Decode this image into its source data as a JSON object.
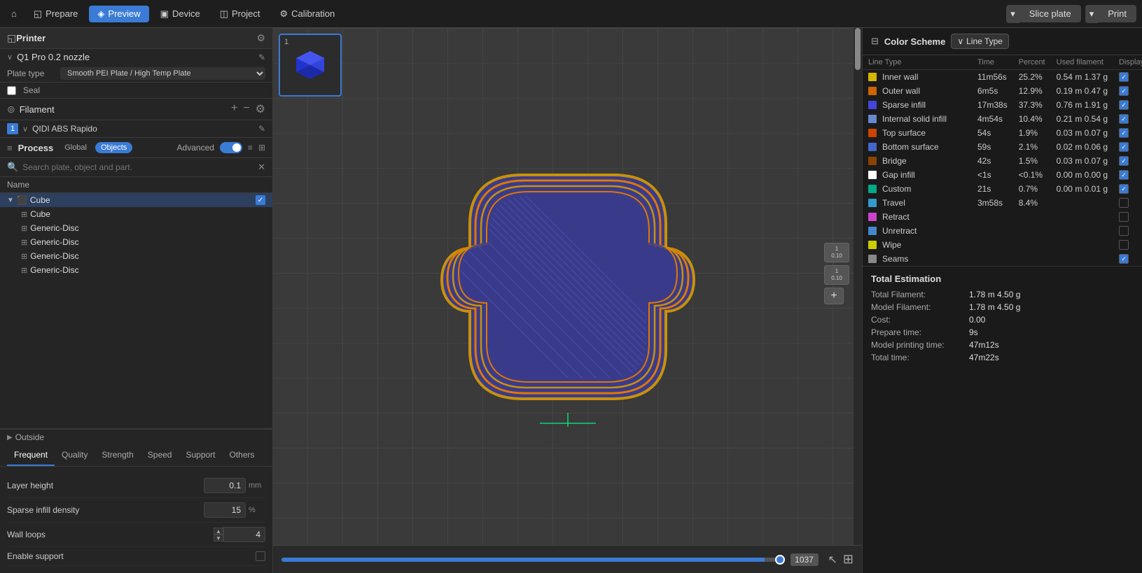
{
  "topbar": {
    "home_icon": "⌂",
    "prepare_label": "Prepare",
    "preview_label": "Preview",
    "device_label": "Device",
    "project_label": "Project",
    "calibration_label": "Calibration",
    "slice_label": "Slice plate",
    "print_label": "Print"
  },
  "left": {
    "printer_section": "Printer",
    "gear_icon": "⚙",
    "printer_name": "Q1 Pro 0.2 nozzle",
    "edit_icon": "✎",
    "plate_label": "Plate type",
    "plate_value": "Smooth PEI Plate / High Temp Plate",
    "seal_label": "Seal",
    "filament_label": "Filament",
    "filament_add": "+",
    "filament_remove": "−",
    "filament_num": "1",
    "filament_name": "QIDI ABS Rapido",
    "process_label": "Process",
    "global_tab": "Global",
    "objects_tab": "Objects",
    "advanced_label": "Advanced",
    "search_placeholder": "Search plate, object and part.",
    "tree_name_col": "Name",
    "tree_items": [
      {
        "label": "Cube",
        "level": 0,
        "type": "group",
        "checked": true
      },
      {
        "label": "Cube",
        "level": 1,
        "type": "cube"
      },
      {
        "label": "Generic-Disc",
        "level": 1,
        "type": "link"
      },
      {
        "label": "Generic-Disc",
        "level": 1,
        "type": "link"
      },
      {
        "label": "Generic-Disc",
        "level": 1,
        "type": "link"
      },
      {
        "label": "Generic-Disc",
        "level": 1,
        "type": "link"
      }
    ],
    "outside_label": "Outside",
    "tabs": [
      "Frequent",
      "Quality",
      "Strength",
      "Speed",
      "Support",
      "Others"
    ],
    "active_tab": "Frequent",
    "settings": [
      {
        "label": "Layer height",
        "value": "0.1",
        "unit": "mm"
      },
      {
        "label": "Sparse infill density",
        "value": "15",
        "unit": "%"
      },
      {
        "label": "Wall loops",
        "value": "4",
        "unit": ""
      },
      {
        "label": "Enable support",
        "value": "",
        "unit": "checkbox"
      }
    ]
  },
  "canvas": {
    "layer_value": "1037"
  },
  "right": {
    "color_scheme_label": "Color Scheme",
    "line_type_label": "Line Type",
    "columns": [
      "Line Type",
      "Time",
      "Percent",
      "Used filament",
      "Display"
    ],
    "lines": [
      {
        "name": "Inner wall",
        "color": "#d4b800",
        "time": "11m56s",
        "percent": "25.2%",
        "filament": "0.54 m  1.37 g",
        "display": true
      },
      {
        "name": "Outer wall",
        "color": "#cc6600",
        "time": "6m5s",
        "percent": "12.9%",
        "filament": "0.19 m  0.47 g",
        "display": true
      },
      {
        "name": "Sparse infill",
        "color": "#4444dd",
        "time": "17m38s",
        "percent": "37.3%",
        "filament": "0.76 m  1.91 g",
        "display": true
      },
      {
        "name": "Internal solid infill",
        "color": "#6688cc",
        "time": "4m54s",
        "percent": "10.4%",
        "filament": "0.21 m  0.54 g",
        "display": true
      },
      {
        "name": "Top surface",
        "color": "#cc4400",
        "time": "54s",
        "percent": "1.9%",
        "filament": "0.03 m  0.07 g",
        "display": true
      },
      {
        "name": "Bottom surface",
        "color": "#4466cc",
        "time": "59s",
        "percent": "2.1%",
        "filament": "0.02 m  0.06 g",
        "display": true
      },
      {
        "name": "Bridge",
        "color": "#884400",
        "time": "42s",
        "percent": "1.5%",
        "filament": "0.03 m  0.07 g",
        "display": true
      },
      {
        "name": "Gap infill",
        "color": "#ffffff",
        "time": "<1s",
        "percent": "<0.1%",
        "filament": "0.00 m  0.00 g",
        "display": true
      },
      {
        "name": "Custom",
        "color": "#00aa88",
        "time": "21s",
        "percent": "0.7%",
        "filament": "0.00 m  0.01 g",
        "display": true
      },
      {
        "name": "Travel",
        "color": "#3399cc",
        "time": "3m58s",
        "percent": "8.4%",
        "filament": "",
        "display": false
      },
      {
        "name": "Retract",
        "color": "#cc44cc",
        "time": "",
        "percent": "",
        "filament": "",
        "display": false
      },
      {
        "name": "Unretract",
        "color": "#4488cc",
        "time": "",
        "percent": "",
        "filament": "",
        "display": false
      },
      {
        "name": "Wipe",
        "color": "#cccc00",
        "time": "",
        "percent": "",
        "filament": "",
        "display": false
      },
      {
        "name": "Seams",
        "color": "#888888",
        "time": "",
        "percent": "",
        "filament": "",
        "display": true
      }
    ],
    "total_title": "Total Estimation",
    "estimation": [
      {
        "label": "Total Filament:",
        "value": "1.78 m  4.50 g"
      },
      {
        "label": "Model Filament:",
        "value": "1.78 m  4.50 g"
      },
      {
        "label": "Cost:",
        "value": "0.00"
      },
      {
        "label": "Prepare time:",
        "value": "9s"
      },
      {
        "label": "Model printing time:",
        "value": "47m12s"
      },
      {
        "label": "Total time:",
        "value": "47m22s"
      }
    ]
  }
}
